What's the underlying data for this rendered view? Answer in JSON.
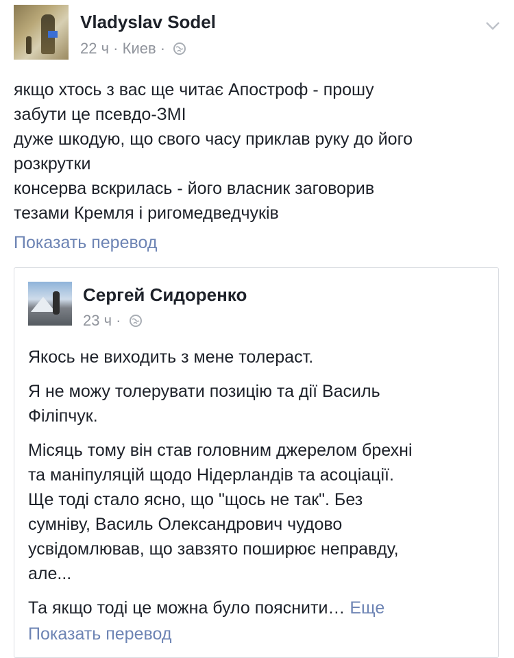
{
  "post": {
    "author": "Vladyslav Sodel",
    "time": "22 ч",
    "separator": "·",
    "location": "Киев",
    "separator2": "·",
    "privacy_icon": "globe-icon",
    "options_icon": "chevron-down-icon",
    "body_lines": [
      "якщо хтось з вас ще читає Апостроф - прошу",
      "забути це псевдо-ЗМІ",
      "дуже шкодую, що свого часу приклав руку до його",
      "розкрутки",
      "консерва вскрилась - його власник заговорив",
      "тезами Кремля і ригомедведчуків"
    ],
    "translate_label": "Показать перевод"
  },
  "shared": {
    "author": "Сергей Сидоренко",
    "time": "23 ч",
    "separator": "·",
    "privacy_icon": "globe-icon",
    "paragraph1": "Якось не виходить з мене толераст.",
    "paragraph2_lines": [
      "Я не можу толерувати позицію та дії Василь",
      "Філіпчук."
    ],
    "paragraph3_lines": [
      "Місяць тому він став головним джерелом брехні",
      "та маніпуляцій щодо Нідерландів та асоціації.",
      "Ще тоді стало ясно, що \"щось не так\". Без",
      "сумніву, Василь Олександрович чудово",
      "усвідомлював, що завзято поширює неправду,",
      "але..."
    ],
    "paragraph4": "Та якщо тоді це можна було пояснити…",
    "more_label": "Еще",
    "translate_label": "Показать перевод"
  }
}
